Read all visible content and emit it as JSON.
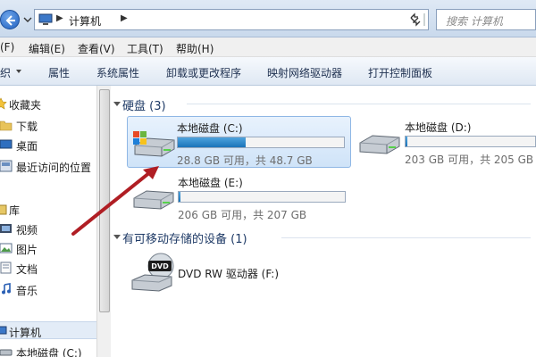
{
  "address_bar": {
    "path": "计算机",
    "search_placeholder": "搜索 计算机"
  },
  "menu": [
    {
      "label": "(F)"
    },
    {
      "label": "编辑(E)"
    },
    {
      "label": "查看(V)"
    },
    {
      "label": "工具(T)"
    },
    {
      "label": "帮助(H)"
    }
  ],
  "toolbar": [
    {
      "label": "织"
    },
    {
      "label": "属性"
    },
    {
      "label": "系统属性"
    },
    {
      "label": "卸载或更改程序"
    },
    {
      "label": "映射网络驱动器"
    },
    {
      "label": "打开控制面板"
    }
  ],
  "nav": {
    "favorites": "收藏夹",
    "download": "下载",
    "desktop": "桌面",
    "recent": "最近访问的位置",
    "library": "库",
    "video": "视频",
    "pictures": "图片",
    "documents": "文档",
    "music": "音乐",
    "computer": "计算机",
    "local_c": "本地磁盘 (C:)"
  },
  "content": {
    "hard_disks_header": "硬盘 (3)",
    "removable_header": "有可移动存储的设备 (1)",
    "drives": [
      {
        "name": "本地磁盘 (C:)",
        "size_text": "28.8 GB 可用，共 48.7 GB",
        "used_fraction": 0.41
      },
      {
        "name": "本地磁盘 (D:)",
        "size_text": "203 GB 可用，共 205 GB",
        "used_fraction": 0.01
      },
      {
        "name": "本地磁盘 (E:)",
        "size_text": "206 GB 可用，共 207 GB",
        "used_fraction": 0.005
      }
    ],
    "dvd": {
      "name": "DVD RW 驱动器 (F:)",
      "label": "DVD"
    }
  },
  "colors": {
    "accent_bar": "#1b74b9",
    "annotation_arrow": "#b01e24"
  }
}
